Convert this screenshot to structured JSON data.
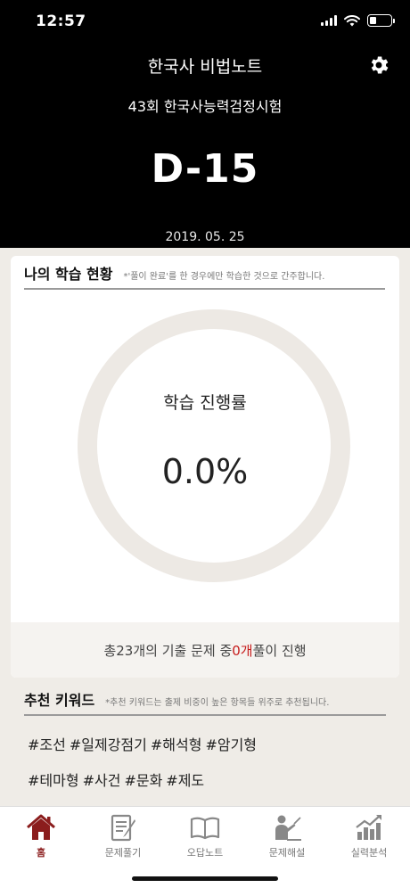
{
  "status_bar": {
    "time": "12:57",
    "icons": [
      "signal-icon",
      "wifi-icon",
      "battery-icon"
    ]
  },
  "header": {
    "app_title": "한국사 비법노트",
    "exam_name": "43회 한국사능력검정시험",
    "d_day": "D-15",
    "exam_date": "2019. 05. 25",
    "settings_icon": "gear-icon"
  },
  "progress_section": {
    "title": "나의 학습 현황",
    "note": "*'풀이 완료'를 한 경우에만 학습한 것으로 간주합니다.",
    "ring_label": "학습 진행률",
    "ring_value": "0.0%",
    "progress_fraction": 0.0,
    "summary": {
      "prefix": "총 ",
      "total": "23개",
      "middle": "의 기출 문제 중 ",
      "done": "0개",
      "suffix": " 풀이 진행"
    }
  },
  "keyword_section": {
    "title": "추천 키워드",
    "note": "*추천 키워드는 출제 비중이 높은 항목들 위주로 추천됩니다.",
    "row1": [
      "#조선",
      "#일제강점기",
      "#해석형",
      "#암기형"
    ],
    "row2": [
      "#테마형",
      "#사건",
      "#문화",
      "#제도"
    ]
  },
  "tab_bar": {
    "tabs": [
      {
        "label": "홈",
        "icon": "home-icon",
        "active": true
      },
      {
        "label": "문제풀기",
        "icon": "notepad-pencil-icon",
        "active": false
      },
      {
        "label": "오답노트",
        "icon": "open-book-icon",
        "active": false
      },
      {
        "label": "문제해설",
        "icon": "teacher-icon",
        "active": false
      },
      {
        "label": "실력분석",
        "icon": "bar-chart-icon",
        "active": false
      }
    ]
  },
  "colors": {
    "header_bg": "#000000",
    "accent": "#8b1d1d",
    "highlight": "#c61b1b",
    "ring_track": "#ede9e4"
  }
}
